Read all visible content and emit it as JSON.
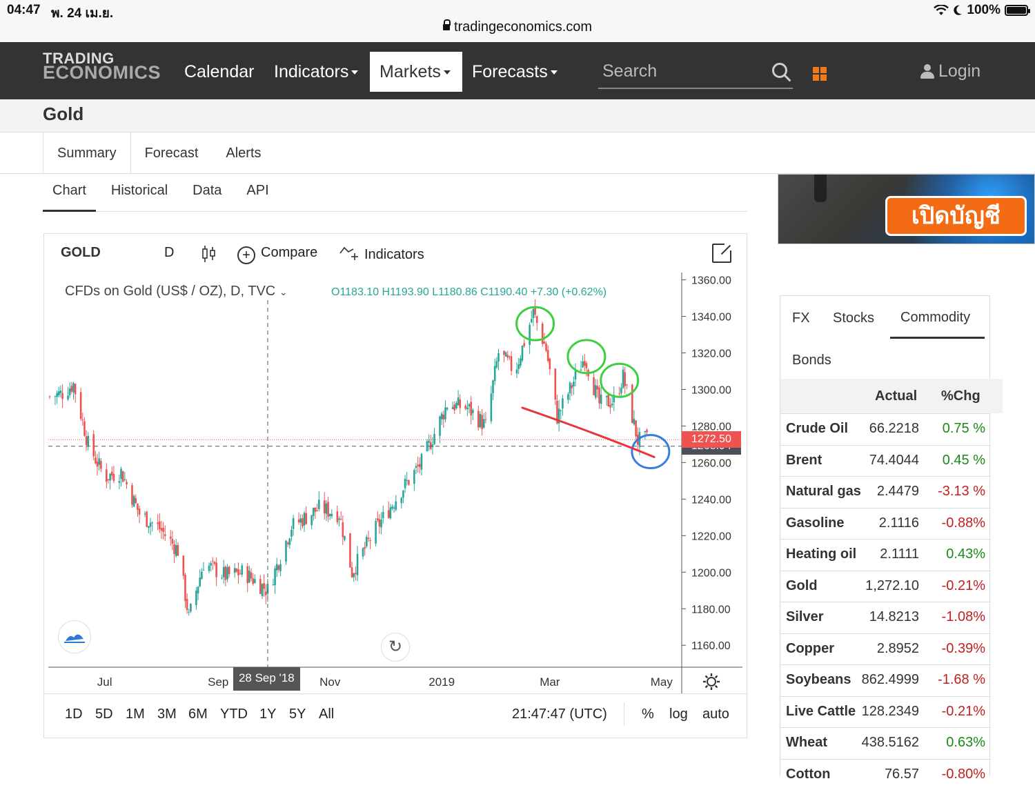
{
  "status_bar": {
    "time": "04:47",
    "date": "พ. 24 เม.ย.",
    "battery": "100%",
    "battery_level": 1.0
  },
  "browser": {
    "url": "tradingeconomics.com"
  },
  "navbar": {
    "logo_line1": "TRADING",
    "logo_line2": "ECONOMICS",
    "items": [
      {
        "label": "Calendar",
        "dropdown": false,
        "active": false
      },
      {
        "label": "Indicators",
        "dropdown": true,
        "active": false
      },
      {
        "label": "Markets",
        "dropdown": true,
        "active": true
      },
      {
        "label": "Forecasts",
        "dropdown": true,
        "active": false
      }
    ],
    "search_placeholder": "Search",
    "login_label": "Login",
    "accent_color": "#f07a1a"
  },
  "page": {
    "title": "Gold"
  },
  "main_tabs": [
    "Summary",
    "Forecast",
    "Alerts"
  ],
  "sub_tabs": [
    {
      "label": "Chart",
      "active": true
    },
    {
      "label": "Historical",
      "active": false
    },
    {
      "label": "Data",
      "active": false
    },
    {
      "label": "API",
      "active": false
    }
  ],
  "chart_widget": {
    "symbol": "GOLD",
    "interval": "D",
    "compare_label": "Compare",
    "indicators_label": "Indicators",
    "legend_title": "CFDs on Gold (US$ / OZ), D, TVC",
    "ohlc": "O1183.10 H1193.90 L1180.86 C1190.40 +7.30 (+0.62%)",
    "crosshair_price": "1268.94",
    "last_price": "1272.50",
    "crosshair_date": "28 Sep '18",
    "clock": "21:47:47 (UTC)",
    "ranges": [
      "1D",
      "5D",
      "1M",
      "3M",
      "6M",
      "YTD",
      "1Y",
      "5Y",
      "All"
    ],
    "scale_options": [
      "%",
      "log",
      "auto"
    ],
    "up_color": "#26a69a",
    "down_color": "#ef5350",
    "crosshair_tag_color": "#4a4f5a",
    "last_price_tag_color": "#ef5350"
  },
  "chart_data": {
    "type": "candlestick",
    "title": "",
    "x_tick_labels": [
      "Jul",
      "Sep",
      "Nov",
      "2019",
      "Mar",
      "May"
    ],
    "y_tick_labels": [
      "1360.00",
      "1340.00",
      "1320.00",
      "1300.00",
      "1280.00",
      "1260.00",
      "1240.00",
      "1220.00",
      "1200.00",
      "1180.00",
      "1160.00"
    ],
    "ylim": [
      1148,
      1364
    ],
    "close_series": [
      {
        "date": "2018-06-01",
        "close": 1296
      },
      {
        "date": "2018-06-08",
        "close": 1298
      },
      {
        "date": "2018-06-14",
        "close": 1303
      },
      {
        "date": "2018-06-22",
        "close": 1270
      },
      {
        "date": "2018-07-01",
        "close": 1252
      },
      {
        "date": "2018-07-10",
        "close": 1255
      },
      {
        "date": "2018-07-20",
        "close": 1232
      },
      {
        "date": "2018-07-31",
        "close": 1224
      },
      {
        "date": "2018-08-10",
        "close": 1212
      },
      {
        "date": "2018-08-16",
        "close": 1175
      },
      {
        "date": "2018-08-24",
        "close": 1205
      },
      {
        "date": "2018-09-05",
        "close": 1198
      },
      {
        "date": "2018-09-15",
        "close": 1200
      },
      {
        "date": "2018-09-28",
        "close": 1190
      },
      {
        "date": "2018-10-11",
        "close": 1225
      },
      {
        "date": "2018-10-26",
        "close": 1235
      },
      {
        "date": "2018-11-06",
        "close": 1232
      },
      {
        "date": "2018-11-13",
        "close": 1200
      },
      {
        "date": "2018-11-25",
        "close": 1222
      },
      {
        "date": "2018-12-10",
        "close": 1245
      },
      {
        "date": "2018-12-21",
        "close": 1260
      },
      {
        "date": "2019-01-04",
        "close": 1292
      },
      {
        "date": "2019-01-15",
        "close": 1290
      },
      {
        "date": "2019-01-25",
        "close": 1280
      },
      {
        "date": "2019-02-01",
        "close": 1320
      },
      {
        "date": "2019-02-10",
        "close": 1310
      },
      {
        "date": "2019-02-20",
        "close": 1342
      },
      {
        "date": "2019-02-27",
        "close": 1322
      },
      {
        "date": "2019-03-05",
        "close": 1285
      },
      {
        "date": "2019-03-12",
        "close": 1300
      },
      {
        "date": "2019-03-20",
        "close": 1318
      },
      {
        "date": "2019-03-28",
        "close": 1292
      },
      {
        "date": "2019-04-05",
        "close": 1294
      },
      {
        "date": "2019-04-10",
        "close": 1307
      },
      {
        "date": "2019-04-18",
        "close": 1272
      },
      {
        "date": "2019-04-23",
        "close": 1272.5
      }
    ],
    "crosshair": {
      "date": "2018-09-28",
      "price": 1268.94
    },
    "last_price": 1272.5,
    "annotations": [
      {
        "type": "circle",
        "color": "#3ecf3e",
        "date": "2019-02-21",
        "price": 1336
      },
      {
        "type": "circle",
        "color": "#3ecf3e",
        "date": "2019-03-21",
        "price": 1318
      },
      {
        "type": "circle",
        "color": "#3ecf3e",
        "date": "2019-04-08",
        "price": 1305
      },
      {
        "type": "circle",
        "color": "#3a7de0",
        "date": "2019-04-25",
        "price": 1266
      },
      {
        "type": "curve",
        "color": "#e8343a",
        "points": [
          {
            "date": "2019-02-14",
            "price": 1290
          },
          {
            "date": "2019-03-09",
            "price": 1282
          },
          {
            "date": "2019-04-15",
            "price": 1268
          },
          {
            "date": "2019-04-27",
            "price": 1263
          }
        ]
      }
    ]
  },
  "ad": {
    "top_text": "เปิดบัญชี",
    "banner_text": "เปิดบัญชี"
  },
  "market_panel": {
    "tabs": [
      {
        "label": "FX",
        "active": false
      },
      {
        "label": "Stocks",
        "active": false
      },
      {
        "label": "Commodity",
        "active": true
      },
      {
        "label": "Bonds",
        "active": false
      }
    ],
    "headers": {
      "actual": "Actual",
      "chg": "%Chg"
    },
    "rows": [
      {
        "name": "Crude Oil",
        "actual": "66.2218",
        "chg": "0.75 %",
        "dir": "pos"
      },
      {
        "name": "Brent",
        "actual": "74.4044",
        "chg": "0.45 %",
        "dir": "pos"
      },
      {
        "name": "Natural gas",
        "actual": "2.4479",
        "chg": "-3.13 %",
        "dir": "neg"
      },
      {
        "name": "Gasoline",
        "actual": "2.1116",
        "chg": "-0.88%",
        "dir": "neg"
      },
      {
        "name": "Heating oil",
        "actual": "2.1111",
        "chg": "0.43%",
        "dir": "pos"
      },
      {
        "name": "Gold",
        "actual": "1,272.10",
        "chg": "-0.21%",
        "dir": "neg"
      },
      {
        "name": "Silver",
        "actual": "14.8213",
        "chg": "-1.08%",
        "dir": "neg"
      },
      {
        "name": "Copper",
        "actual": "2.8952",
        "chg": "-0.39%",
        "dir": "neg"
      },
      {
        "name": "Soybeans",
        "actual": "862.4999",
        "chg": "-1.68 %",
        "dir": "neg"
      },
      {
        "name": "Live Cattle",
        "actual": "128.2349",
        "chg": "-0.21%",
        "dir": "neg"
      },
      {
        "name": "Wheat",
        "actual": "438.5162",
        "chg": "0.63%",
        "dir": "pos"
      },
      {
        "name": "Cotton",
        "actual": "76.57",
        "chg": "-0.80%",
        "dir": "neg"
      }
    ]
  }
}
